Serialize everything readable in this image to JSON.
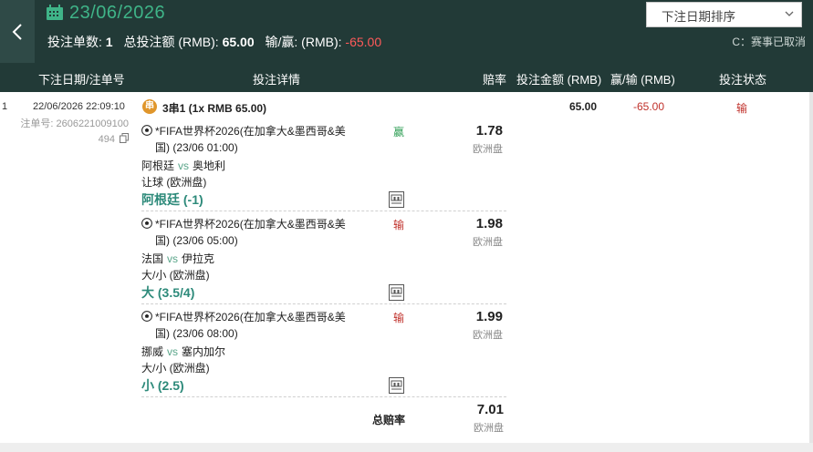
{
  "header": {
    "date": "23/06/2026",
    "sort_label": "下注日期排序",
    "summary": {
      "count_label": "投注单数:",
      "count": "1",
      "total_label": "总投注额 (RMB):",
      "total": "65.00",
      "winloss_label": "输/赢: (RMB):",
      "winloss": "-65.00"
    },
    "note": "C：赛事已取消"
  },
  "columns": [
    "下注日期/注单号",
    "投注详情",
    "赔率",
    "投注金额 (RMB)",
    "赢/输 (RMB)",
    "投注状态"
  ],
  "bet": {
    "row_no": "1",
    "date": "22/06/2026 22:09:10",
    "id_label": "注单号:",
    "id": "2606221009100494",
    "combo_icon": "串",
    "combo": "3串1 (1x RMB 65.00)",
    "amount": "65.00",
    "winloss": "-65.00",
    "status": "输",
    "legs": [
      {
        "league": "*FIFA世界杯2026(在加拿大&墨西哥&美国) (23/06 01:00)",
        "home": "阿根廷",
        "vs": "vs",
        "away": "奥地利",
        "market": "让球 (欧洲盘)",
        "pick": "阿根廷 (-1)",
        "result": "赢",
        "odds": "1.78",
        "odds_type": "欧洲盘"
      },
      {
        "league": "*FIFA世界杯2026(在加拿大&墨西哥&美国) (23/06 05:00)",
        "home": "法国",
        "vs": "vs",
        "away": "伊拉克",
        "market": "大/小 (欧洲盘)",
        "pick": "大 (3.5/4)",
        "result": "输",
        "odds": "1.98",
        "odds_type": "欧洲盘"
      },
      {
        "league": "*FIFA世界杯2026(在加拿大&墨西哥&美国) (23/06 08:00)",
        "home": "挪威",
        "vs": "vs",
        "away": "塞内加尔",
        "market": "大/小 (欧洲盘)",
        "pick": "小 (2.5)",
        "result": "输",
        "odds": "1.99",
        "odds_type": "欧洲盘"
      }
    ],
    "total_label": "总赔率",
    "total_odds": "7.01",
    "total_odds_type": "欧洲盘"
  },
  "colors": {
    "header_bg": "#223a37",
    "date_green": "#3fb488",
    "loss_red": "#c0312b",
    "win_green": "#2f9e55",
    "pick_teal": "#2d8a7a",
    "combo_orange": "#e0962b"
  },
  "icons": [
    "back-chevron-icon",
    "calendar-icon",
    "dropdown-chevron-icon",
    "copy-icon",
    "football-icon",
    "stats-icon"
  ]
}
